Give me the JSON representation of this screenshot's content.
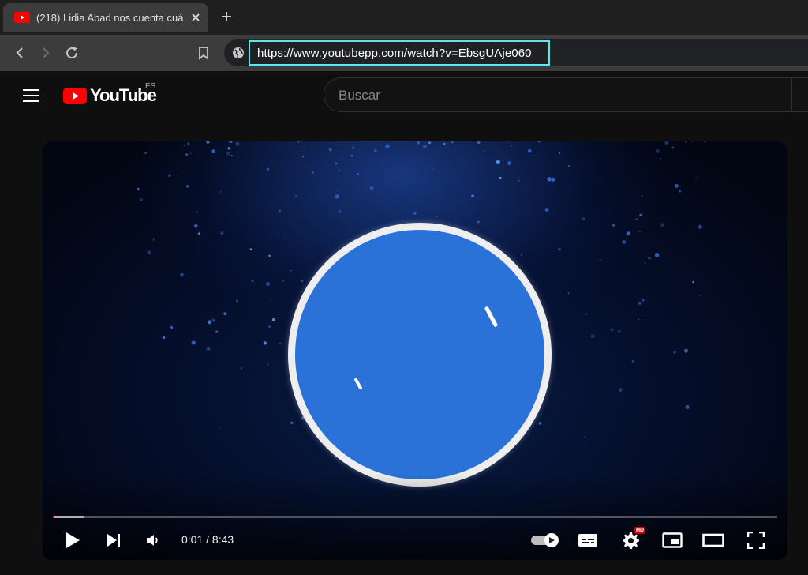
{
  "browser": {
    "tab": {
      "title": "(218) Lidia Abad nos cuenta cuá",
      "favicon": "youtube-favicon"
    },
    "url": "https://www.youtubepp.com/watch?v=EbsgUAje060"
  },
  "youtube": {
    "logo_text": "YouTube",
    "country_code": "ES",
    "search_placeholder": "Buscar"
  },
  "player": {
    "current_time": "0:01",
    "duration": "8:43",
    "time_display": "0:01 / 8:43",
    "progress_fraction": 0.0019,
    "buffered_fraction": 0.04,
    "quality_badge": "HD",
    "icons": [
      "play-icon",
      "next-icon",
      "volume-icon",
      "autoplay-toggle-icon",
      "subtitles-icon",
      "settings-icon",
      "miniplayer-icon",
      "theater-mode-icon",
      "fullscreen-icon"
    ]
  },
  "colors": {
    "youtube_red": "#ff0000",
    "url_highlight": "#5ee6ef",
    "bubble_blue": "#2a72d8"
  }
}
